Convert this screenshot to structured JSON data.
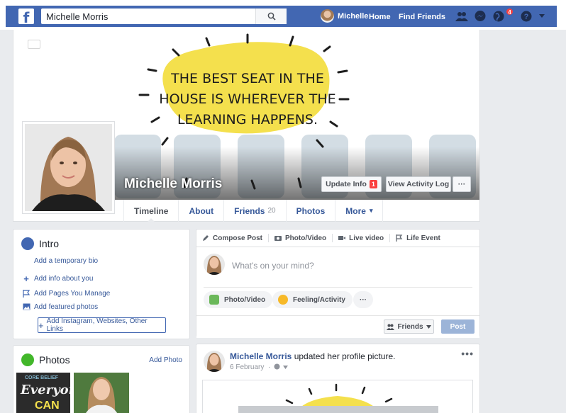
{
  "topbar": {
    "logo": "f",
    "search_value": "Michelle Morris",
    "search_placeholder": "Search",
    "user_name": "Michelle",
    "home_label": "Home",
    "find_friends_label": "Find Friends",
    "notification_count": "4",
    "icons": [
      "friend-requests-icon",
      "messenger-icon",
      "notifications-globe-icon",
      "help-icon",
      "caret-down-icon"
    ],
    "bar_color": "#4267b2"
  },
  "cover": {
    "quote_line1": "THE BEST SEAT IN THE",
    "quote_line2": "HOUSE IS WHEREVER THE",
    "quote_line3": "LEARNING HAPPENS.",
    "sun_color": "#f4e04d"
  },
  "profile": {
    "name": "Michelle Morris",
    "update_info_label": "Update Info",
    "update_info_badge": "1",
    "activity_log_label": "View Activity Log",
    "more_dots": "···"
  },
  "tabs": [
    {
      "label": "Timeline",
      "active": true
    },
    {
      "label": "About"
    },
    {
      "label": "Friends",
      "count": "20"
    },
    {
      "label": "Photos"
    },
    {
      "label": "More",
      "caret": "▾"
    }
  ],
  "intro": {
    "title": "Intro",
    "temp_bio": "Add a temporary bio",
    "items": [
      {
        "icon": "plus-icon",
        "label": "Add info about you"
      },
      {
        "icon": "flag-icon",
        "label": "Add Pages You Manage"
      },
      {
        "icon": "photo-icon",
        "label": "Add featured photos"
      }
    ],
    "links_button": "Add Instagram, Websites, Other Links"
  },
  "composer": {
    "tabs": [
      "Compose Post",
      "Photo/Video",
      "Live video",
      "Life Event"
    ],
    "placeholder": "What's on your mind?",
    "pills": [
      "Photo/Video",
      "Feeling/Activity",
      "···"
    ],
    "audience": "Friends",
    "post_label": "Post"
  },
  "photos": {
    "title": "Photos",
    "add_label": "Add Photo",
    "thumb1_line1": "CORE BELIEF",
    "thumb1_line2": "Everyon",
    "thumb1_line3": "CAN"
  },
  "post": {
    "author": "Michelle Morris",
    "action": "updated her profile picture.",
    "date": "6 February",
    "more": "•••"
  }
}
